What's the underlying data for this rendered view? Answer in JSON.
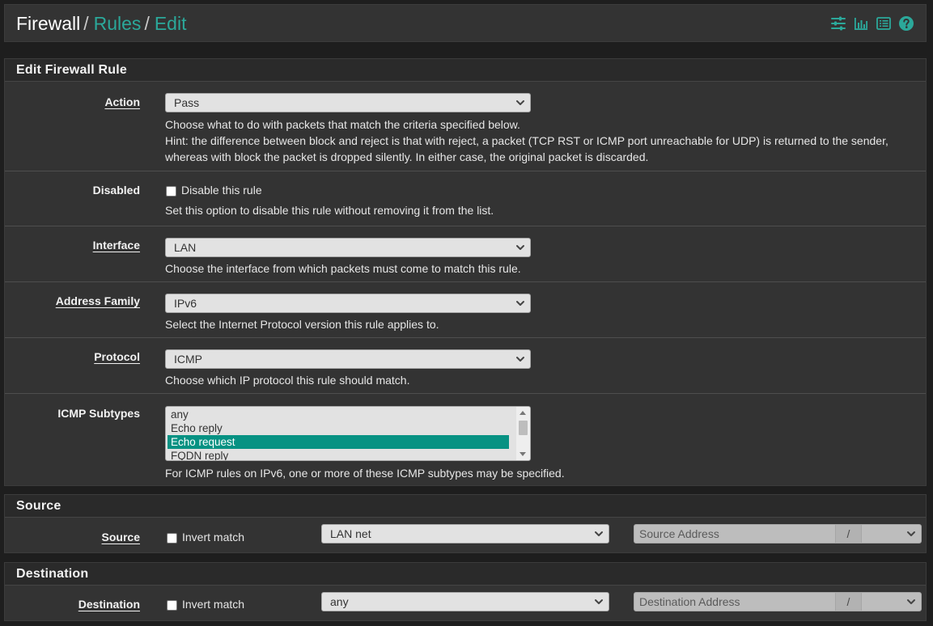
{
  "breadcrumb": {
    "home": "Firewall",
    "rules": "Rules",
    "edit": "Edit"
  },
  "header_icons": [
    "sliders-icon",
    "bar-chart-icon",
    "list-icon",
    "help-icon"
  ],
  "edit_panel": {
    "title": "Edit Firewall Rule",
    "action": {
      "label": "Action",
      "value": "Pass",
      "help_line1": "Choose what to do with packets that match the criteria specified below.",
      "help_line2": "Hint: the difference between block and reject is that with reject, a packet (TCP RST or ICMP port unreachable for UDP) is returned to the sender,",
      "help_line3": "whereas with block the packet is dropped silently. In either case, the original packet is discarded."
    },
    "disabled": {
      "label": "Disabled",
      "checkbox_label": "Disable this rule",
      "help": "Set this option to disable this rule without removing it from the list."
    },
    "interface": {
      "label": "Interface",
      "value": "LAN",
      "help": "Choose the interface from which packets must come to match this rule."
    },
    "address_family": {
      "label": "Address Family",
      "value": "IPv6",
      "help": "Select the Internet Protocol version this rule applies to."
    },
    "protocol": {
      "label": "Protocol",
      "value": "ICMP",
      "help": "Choose which IP protocol this rule should match."
    },
    "icmp_subtypes": {
      "label": "ICMP Subtypes",
      "options": [
        "any",
        "Echo reply",
        "Echo request",
        "FQDN reply"
      ],
      "selected": "Echo request",
      "help": "For ICMP rules on IPv6, one or more of these ICMP subtypes may be specified."
    }
  },
  "source_panel": {
    "title": "Source",
    "label": "Source",
    "invert_label": "Invert match",
    "type_value": "LAN net",
    "address_placeholder": "Source Address",
    "slash": "/"
  },
  "destination_panel": {
    "title": "Destination",
    "label": "Destination",
    "invert_label": "Invert match",
    "type_value": "any",
    "address_placeholder": "Destination Address",
    "slash": "/"
  },
  "colors": {
    "accent": "#2ba89a",
    "selected": "#079283",
    "panel": "#333333",
    "background": "#1e1e1e"
  }
}
